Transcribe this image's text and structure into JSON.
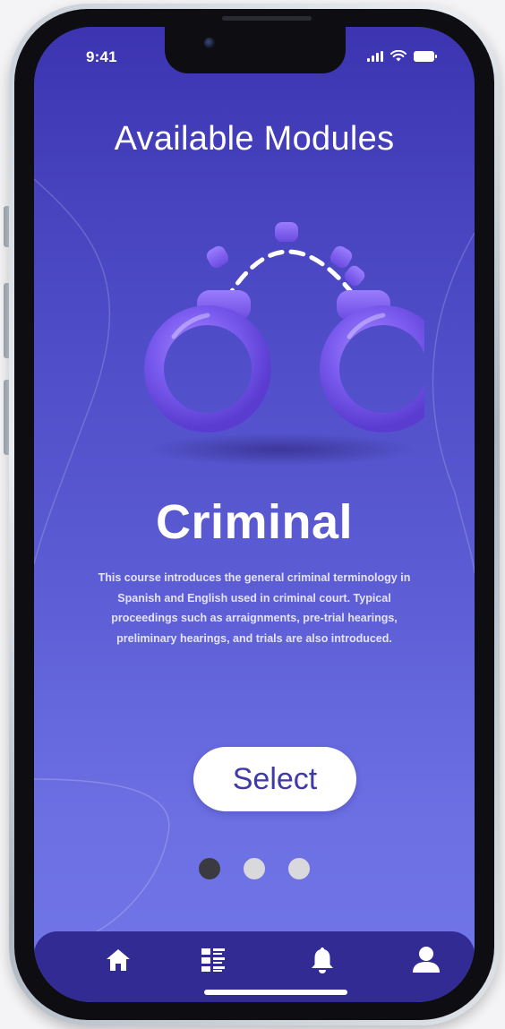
{
  "status_bar": {
    "time": "9:41",
    "signal_icon": "cellular-signal-icon",
    "wifi_icon": "wifi-icon",
    "battery_icon": "battery-icon"
  },
  "page": {
    "title": "Available Modules"
  },
  "module": {
    "name": "Criminal",
    "illustration": "handcuffs-icon",
    "description": "This course introduces the general criminal terminology in Spanish and English used in criminal court. Typical proceedings such as arraignments, pre-trial hearings, preliminary hearings, and trials are also introduced.",
    "select_label": "Select"
  },
  "pagination": {
    "count": 3,
    "active_index": 0
  },
  "tab_bar": {
    "items": [
      {
        "icon": "home-icon"
      },
      {
        "icon": "list-icon"
      },
      {
        "icon": "bell-icon"
      },
      {
        "icon": "user-icon"
      }
    ]
  },
  "colors": {
    "background_top": "#3c34b0",
    "background_bottom": "#7176e8",
    "tab_bar": "#312b93",
    "accent_purple": "#7b5cf0",
    "button_text": "#3f3aa8",
    "dot_active": "#3a3a40",
    "dot_inactive": "#d9d8dc"
  }
}
